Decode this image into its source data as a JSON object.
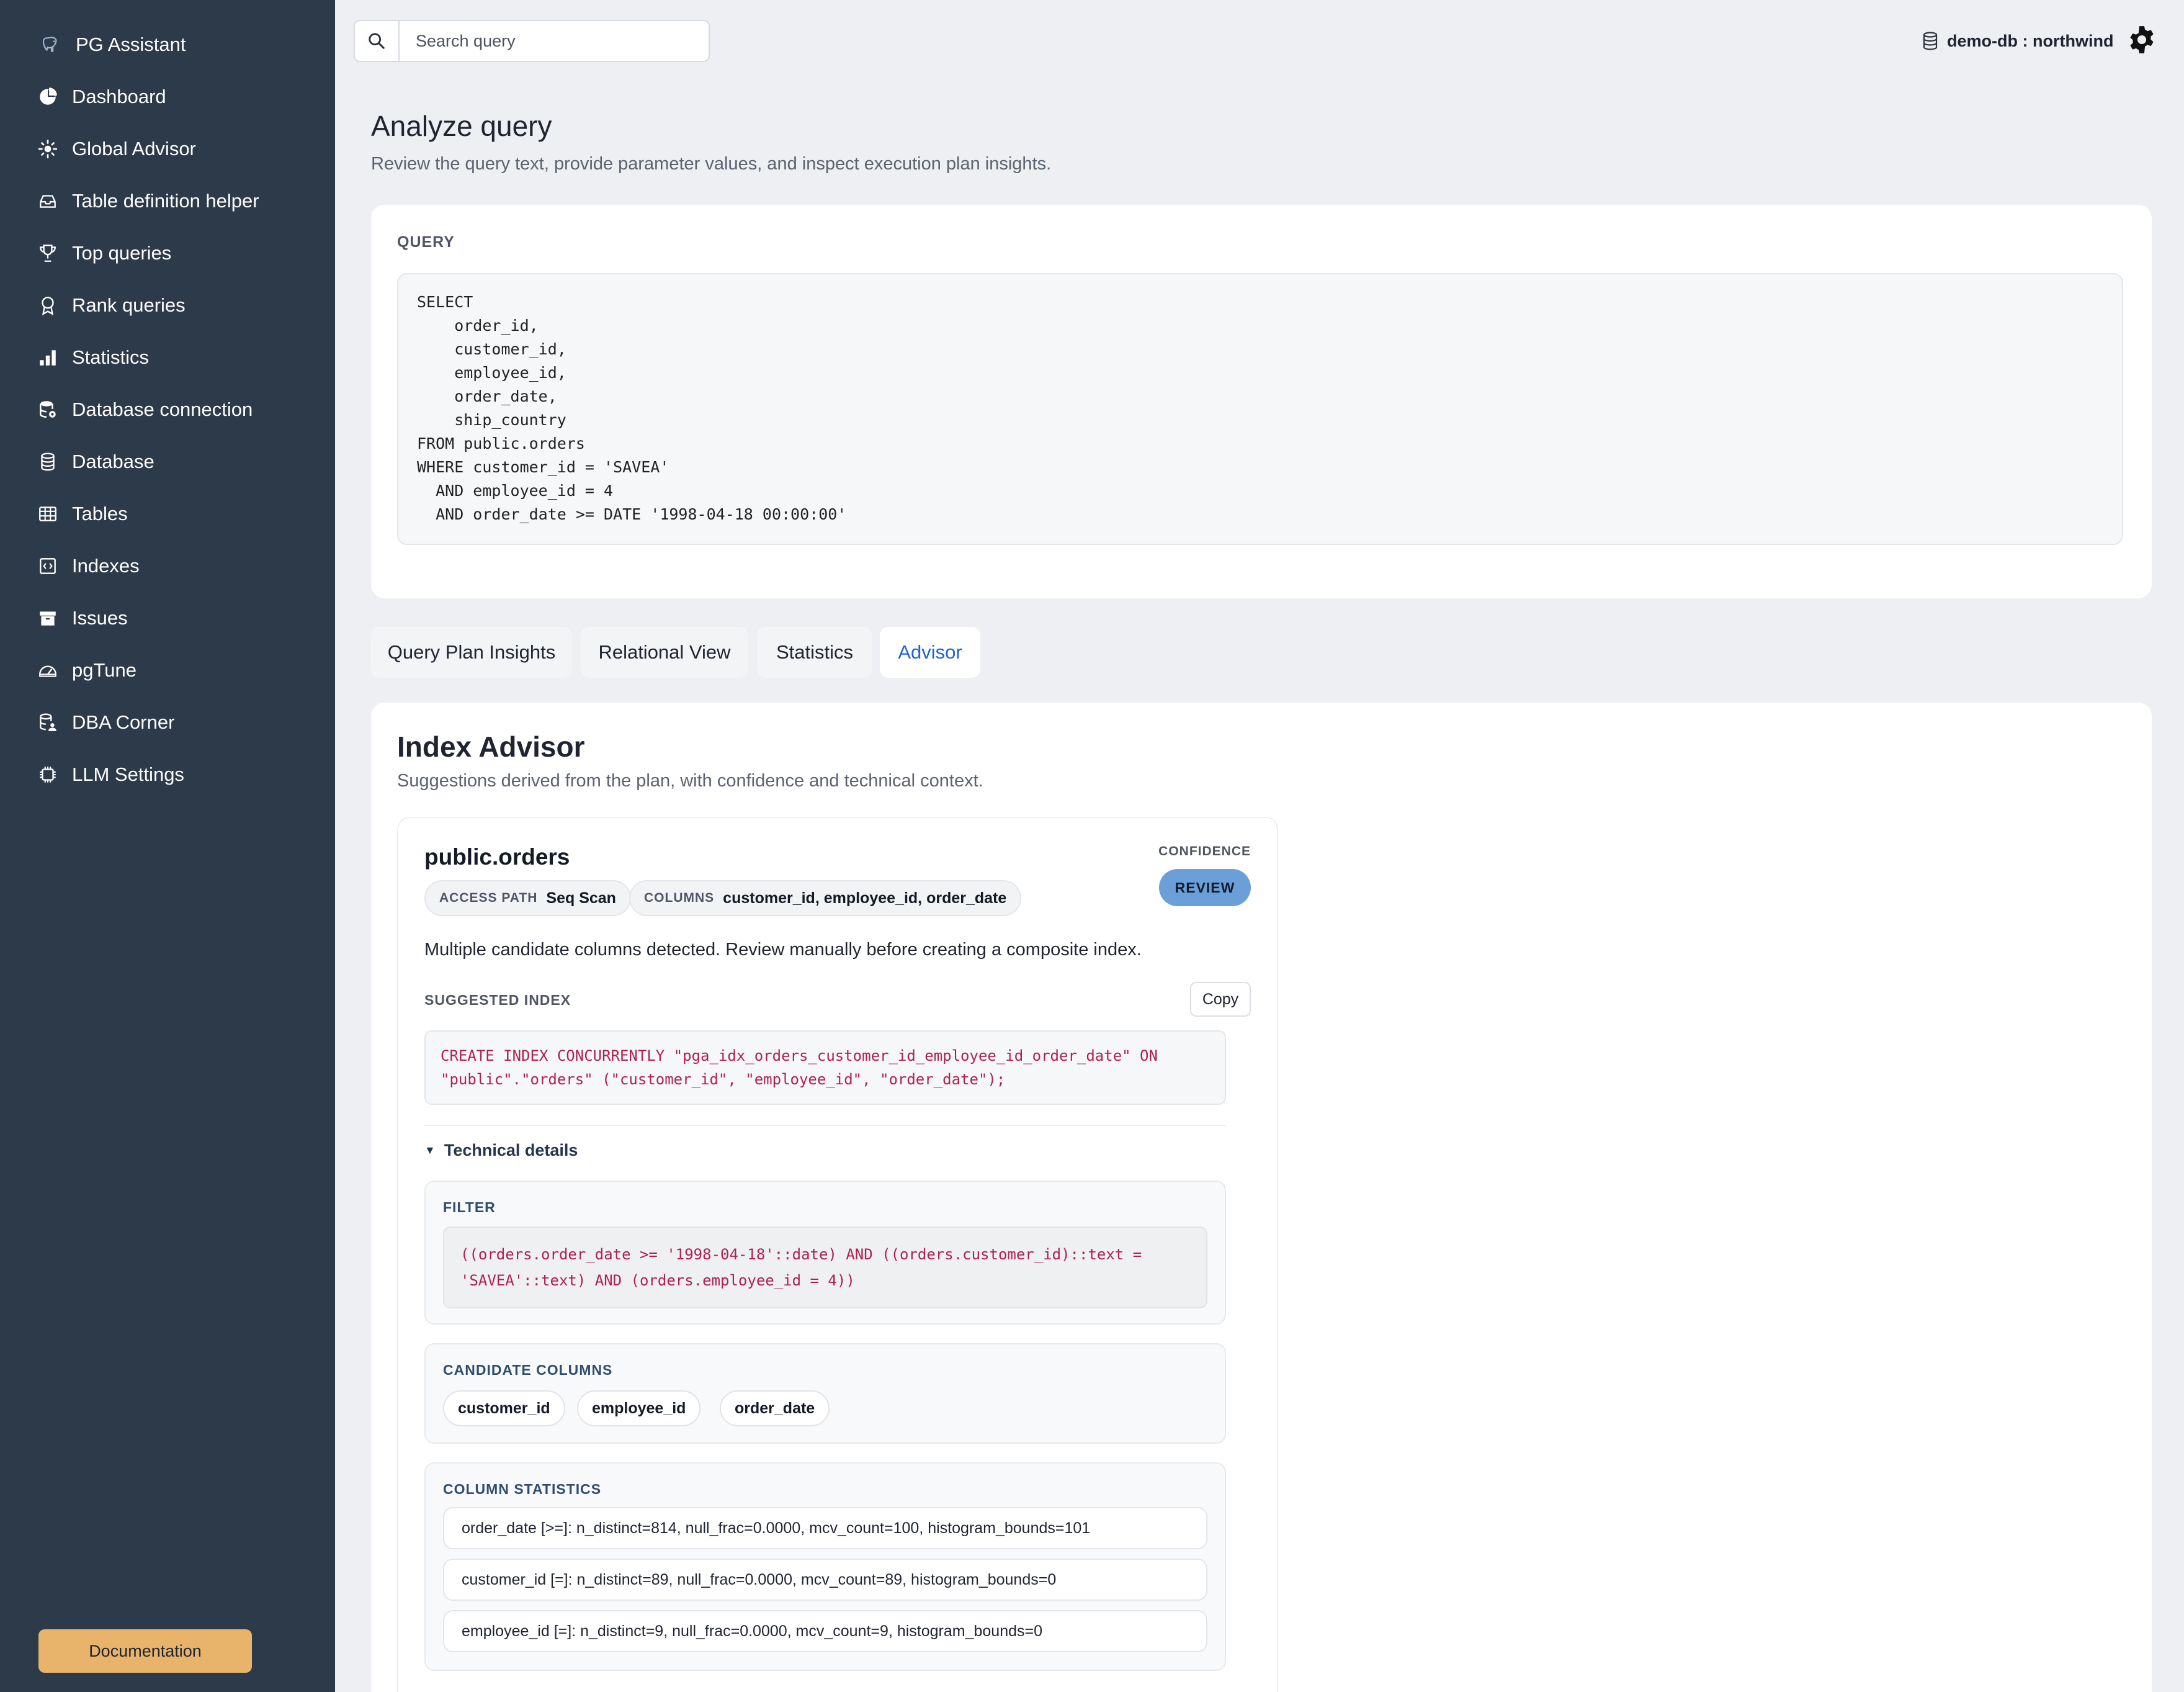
{
  "app": {
    "name": "PG Assistant"
  },
  "sidebar": {
    "items": [
      {
        "label": "Dashboard",
        "icon": "pie-chart-icon"
      },
      {
        "label": "Global Advisor",
        "icon": "sun-icon"
      },
      {
        "label": "Table definition helper",
        "icon": "inbox-icon"
      },
      {
        "label": "Top queries",
        "icon": "trophy-icon"
      },
      {
        "label": "Rank queries",
        "icon": "award-icon"
      },
      {
        "label": "Statistics",
        "icon": "bar-chart-icon"
      },
      {
        "label": "Database connection",
        "icon": "database-gear-icon"
      },
      {
        "label": "Database",
        "icon": "database-icon"
      },
      {
        "label": "Tables",
        "icon": "table-icon"
      },
      {
        "label": "Indexes",
        "icon": "index-icon"
      },
      {
        "label": "Issues",
        "icon": "archive-icon"
      },
      {
        "label": "pgTune",
        "icon": "speedometer-icon"
      },
      {
        "label": "DBA Corner",
        "icon": "database-person-icon"
      },
      {
        "label": "LLM Settings",
        "icon": "cpu-icon"
      }
    ],
    "documentation_label": "Documentation"
  },
  "topbar": {
    "search_placeholder": "Search query",
    "db_label": "demo-db : northwind"
  },
  "page": {
    "title": "Analyze query",
    "subtitle": "Review the query text, provide parameter values, and inspect execution plan insights."
  },
  "query": {
    "label": "QUERY",
    "text": "SELECT\n    order_id,\n    customer_id,\n    employee_id,\n    order_date,\n    ship_country\nFROM public.orders\nWHERE customer_id = 'SAVEA'\n  AND employee_id = 4\n  AND order_date >= DATE '1998-04-18 00:00:00'"
  },
  "tabs": [
    {
      "label": "Query Plan Insights",
      "active": false
    },
    {
      "label": "Relational View",
      "active": false
    },
    {
      "label": "Statistics",
      "active": false
    },
    {
      "label": "Advisor",
      "active": true
    }
  ],
  "advisor": {
    "title": "Index Advisor",
    "subtitle": "Suggestions derived from the plan, with confidence and technical context.",
    "table": "public.orders",
    "confidence_label": "CONFIDENCE",
    "confidence_value": "REVIEW",
    "access_path_label": "ACCESS PATH",
    "access_path_value": "Seq Scan",
    "columns_label": "COLUMNS",
    "columns_value": "customer_id, employee_id, order_date",
    "message": "Multiple candidate columns detected. Review manually before creating a composite index.",
    "suggested_label": "SUGGESTED INDEX",
    "copy_label": "Copy",
    "suggested_sql": "CREATE INDEX CONCURRENTLY \"pga_idx_orders_customer_id_employee_id_order_date\" ON\n\"public\".\"orders\" (\"customer_id\", \"employee_id\", \"order_date\");",
    "technical_details_label": "Technical details",
    "filter_label": "FILTER",
    "filter_text": "((orders.order_date >= '1998-04-18'::date) AND ((orders.customer_id)::text =\n'SAVEA'::text) AND (orders.employee_id = 4))",
    "candidate_label": "CANDIDATE COLUMNS",
    "candidate_columns": [
      "customer_id",
      "employee_id",
      "order_date"
    ],
    "stats_label": "COLUMN STATISTICS",
    "column_stats": [
      "order_date [>=]: n_distinct=814, null_frac=0.0000, mcv_count=100, histogram_bounds=101",
      "customer_id [=]: n_distinct=89, null_frac=0.0000, mcv_count=89, histogram_bounds=0",
      "employee_id [=]: n_distinct=9, null_frac=0.0000, mcv_count=9, histogram_bounds=0"
    ]
  },
  "colors": {
    "sidebar_bg": "#2c3a4a",
    "accent": "#1e63d6",
    "doc_button": "#e8b36b",
    "review_badge": "#6a9fd8",
    "code_text": "#b0214f"
  }
}
